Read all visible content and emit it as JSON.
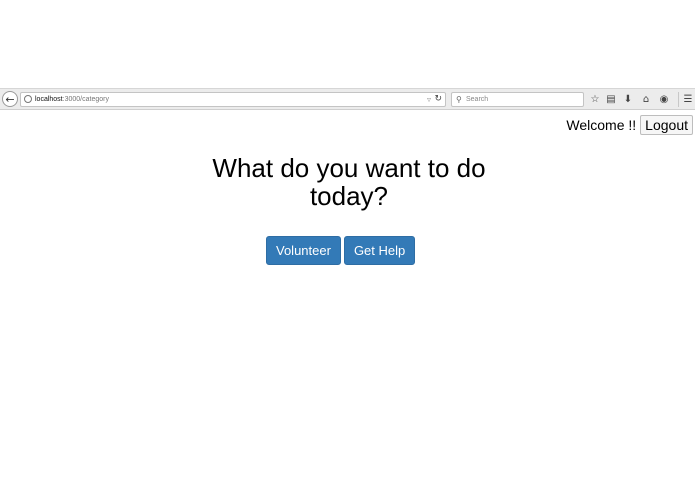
{
  "browser": {
    "url_host": "localhost",
    "url_rest": ":3000/category",
    "search_placeholder": "Search",
    "icons": {
      "back": "arrow-left-icon",
      "site": "globe-icon",
      "reload": "reload-icon",
      "search": "search-icon",
      "bookmark": "star-icon",
      "reading": "clipboard-icon",
      "download": "download-icon",
      "home": "home-icon",
      "chat": "chat-icon",
      "menu": "hamburger-menu-icon"
    }
  },
  "header": {
    "welcome": "Welcome !!",
    "logout_label": "Logout"
  },
  "main": {
    "heading": "What do you want to do today?",
    "buttons": {
      "volunteer": "Volunteer",
      "get_help": "Get Help"
    }
  },
  "colors": {
    "primary": "#337ab7"
  }
}
